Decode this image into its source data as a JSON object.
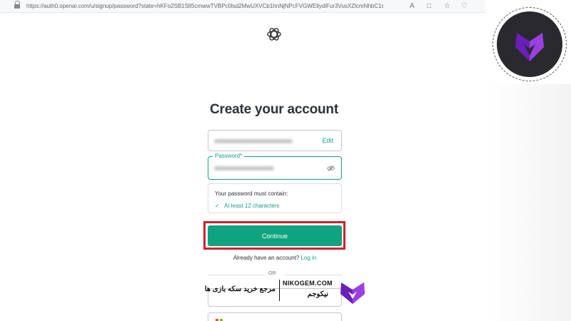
{
  "browser": {
    "url": "https://auth0.openai.com/u/signup/password?state=hKFo2SB1SlI5cmwwTVBPc0lsd2MwUXVCb1hnNjNPcFVGWEllydiFur3VusXZlcmNhbC1sb2dp..."
  },
  "page": {
    "title": "Create your account",
    "email_edit_label": "Edit",
    "password_label": "Password*",
    "requirements_title": "Your password must contain:",
    "requirement_check": "✓",
    "requirement_item": "At least 12 characters",
    "continue_label": "Continue",
    "have_account_text": "Already have an account?",
    "login_link": "Log in",
    "or_label": "OR"
  },
  "watermark": {
    "domain": "NIKOGEM.COM",
    "name": "نیکوجم",
    "tagline": "مرجع خرید سکه بازی ها"
  },
  "colors": {
    "accent": "#10a37f",
    "highlight": "#d0202a",
    "brand_purple": "#7a2bd1"
  },
  "icons": [
    "lock-icon",
    "read-aloud-icon",
    "favorites-icon",
    "openai-logo-icon",
    "eye-icon",
    "microsoft-icon",
    "nikogem-logo"
  ]
}
